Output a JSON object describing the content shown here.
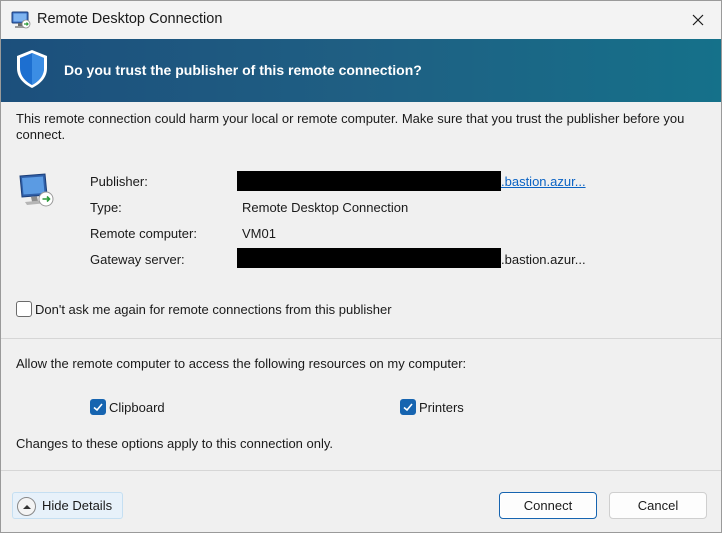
{
  "window": {
    "title": "Remote Desktop Connection",
    "close_icon": "close-icon"
  },
  "banner": {
    "icon": "shield-icon",
    "heading": "Do you trust the publisher of this remote connection?"
  },
  "warning": "This remote connection could harm your local or remote computer. Make sure that you trust the publisher before you connect.",
  "details": {
    "icon": "remote-computer-icon",
    "publisher_label": "Publisher:",
    "publisher_value": ".bastion.azur...",
    "type_label": "Type:",
    "type_value": "Remote Desktop Connection",
    "remote_label": "Remote computer:",
    "remote_value": "VM01",
    "gateway_label": "Gateway server:",
    "gateway_value": ".bastion.azur..."
  },
  "dont_ask": {
    "label": "Don't ask me again for remote connections from this publisher",
    "checked": false
  },
  "resources": {
    "heading": "Allow the remote computer to access the following resources on my computer:",
    "clipboard": {
      "label": "Clipboard",
      "checked": true
    },
    "printers": {
      "label": "Printers",
      "checked": true
    },
    "note": "Changes to these options apply to this connection only."
  },
  "footer": {
    "hide_details": "Hide Details",
    "connect": "Connect",
    "cancel": "Cancel"
  },
  "colors": {
    "banner_start": "#1c4f7c",
    "banner_end": "#15718a",
    "accent": "#1664b0",
    "link": "#0b63c4"
  }
}
